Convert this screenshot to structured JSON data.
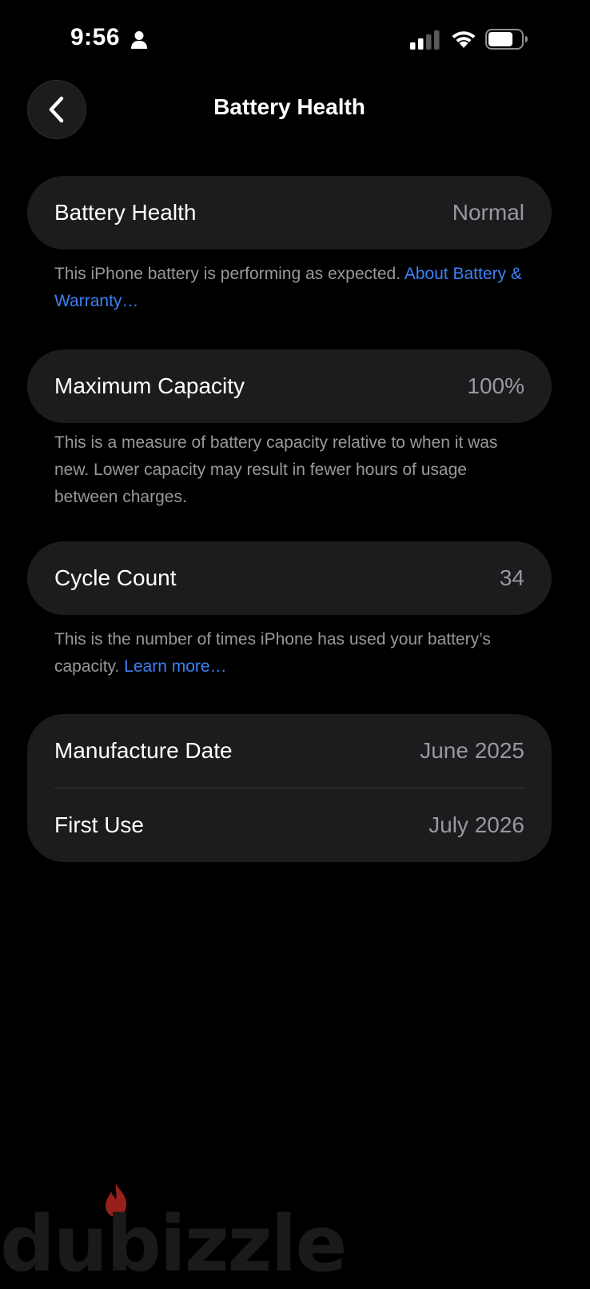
{
  "status_bar": {
    "time": "9:56"
  },
  "nav": {
    "title": "Battery Health"
  },
  "sections": {
    "health": {
      "label": "Battery Health",
      "value": "Normal",
      "note": "This iPhone battery is performing as expected.",
      "link": "About Battery & Warranty…"
    },
    "capacity": {
      "label": "Maximum Capacity",
      "value": "100%",
      "note": "This is a measure of battery capacity relative to when it was new. Lower capacity may result in fewer hours of usage between charges."
    },
    "cycles": {
      "label": "Cycle Count",
      "value": "34",
      "note": "This is the number of times iPhone has used your battery’s capacity.",
      "link": "Learn more…"
    },
    "dates": {
      "manufacture_label": "Manufacture Date",
      "manufacture_value": "June 2025",
      "first_use_label": "First Use",
      "first_use_value": "July 2026"
    }
  },
  "watermark": {
    "text": "dubizzle"
  },
  "colors": {
    "background": "#000000",
    "card": "#1c1c1e",
    "link": "#3b82f6",
    "secondary_text": "#98989d",
    "watermark_flame": "#b3261e"
  },
  "icons": {
    "back": "chevron-left-icon",
    "person": "person-icon",
    "signal": "cellular-signal-icon",
    "wifi": "wifi-icon",
    "battery": "battery-icon"
  }
}
